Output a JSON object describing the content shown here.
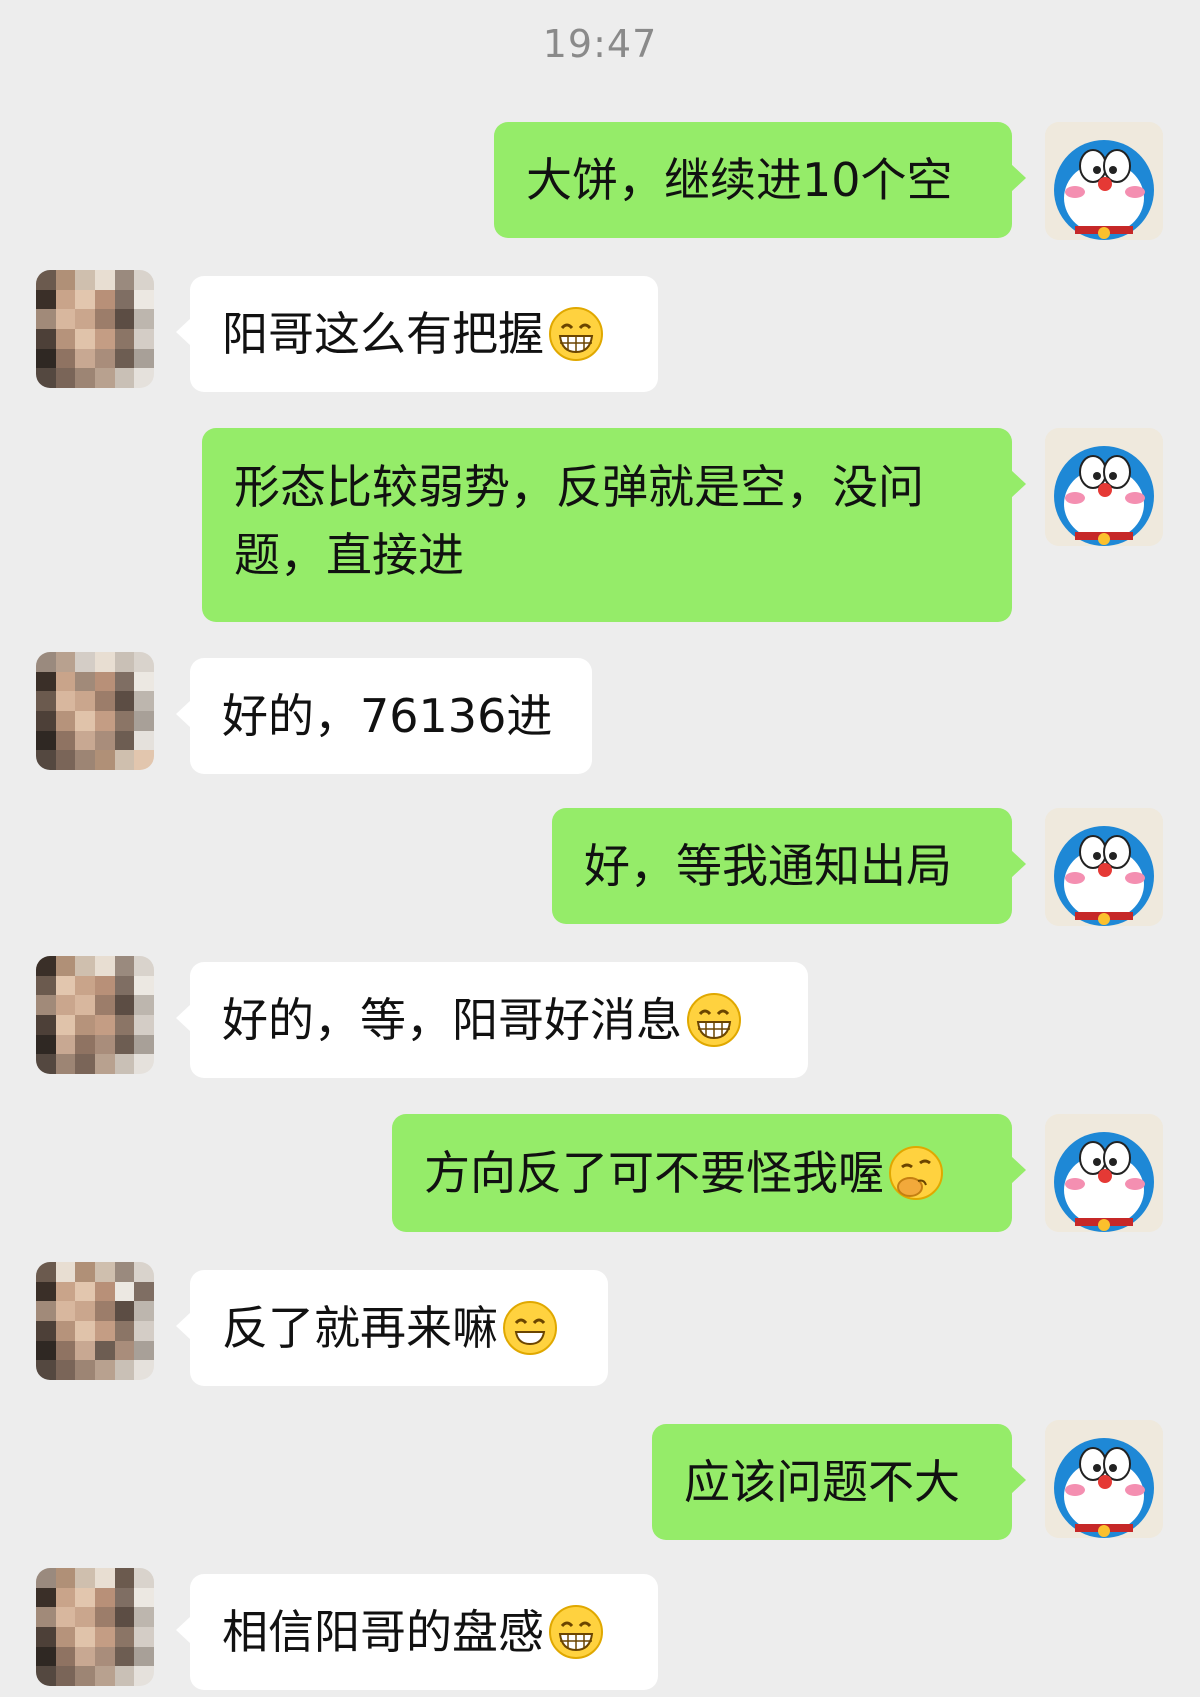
{
  "timestamp": "19:47",
  "messages": [
    {
      "side": "out",
      "text": "大饼，继续进10个空",
      "emoji": ""
    },
    {
      "side": "in",
      "text": "阳哥这么有把握",
      "emoji": "grin-emoji"
    },
    {
      "side": "out",
      "text": "形态比较弱势，反弹就是空，没问题，直接进",
      "emoji": ""
    },
    {
      "side": "in",
      "text": "好的，76136进",
      "emoji": ""
    },
    {
      "side": "out",
      "text": "好，等我通知出局",
      "emoji": ""
    },
    {
      "side": "in",
      "text": "好的，等，阳哥好消息",
      "emoji": "grin-emoji"
    },
    {
      "side": "out",
      "text": "方向反了可不要怪我喔",
      "emoji": "thinking-hand-emoji"
    },
    {
      "side": "in",
      "text": "反了就再来嘛",
      "emoji": "smile-emoji"
    },
    {
      "side": "out",
      "text": "应该问题不大",
      "emoji": ""
    },
    {
      "side": "in",
      "text": "相信阳哥的盘感",
      "emoji": "grin-emoji"
    }
  ],
  "avatars": {
    "self": "doraemon-avatar",
    "other": "pixelated-cat-avatar"
  },
  "colors": {
    "background": "#ededed",
    "outgoing_bubble": "#95ec69",
    "incoming_bubble": "#ffffff"
  }
}
